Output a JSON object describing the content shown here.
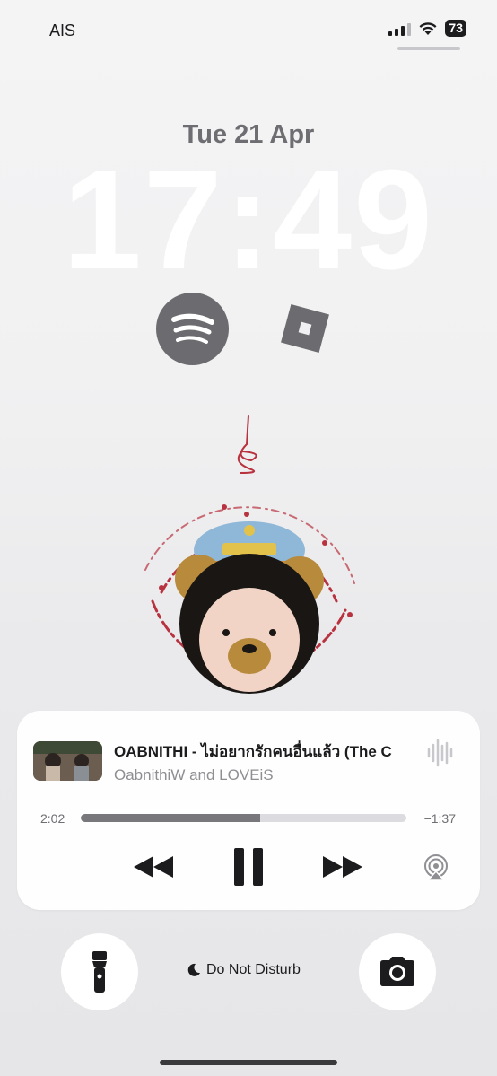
{
  "status_bar": {
    "carrier": "AIS",
    "battery": "73"
  },
  "lock_screen": {
    "date": "Tue 21 Apr",
    "time": "17:49",
    "widgets": [
      "spotify-icon",
      "roblox-icon"
    ]
  },
  "now_playing": {
    "title": "OABNITHI - ไม่อยากรักคนอื่นแล้ว (The C",
    "artist": "OabnithiW and LOVEiS",
    "elapsed": "2:02",
    "remaining": "−1:37",
    "progress": 0.55,
    "controls": [
      "rewind-icon",
      "pause-icon",
      "fast-forward-icon",
      "airplay-icon"
    ]
  },
  "bottom": {
    "dnd_label": "Do Not Disturb",
    "left_button": "flashlight-icon",
    "right_button": "camera-icon"
  },
  "colors": {
    "accent_text": "#1c1c1e",
    "wallpaper_ink": "#b8323f",
    "progress_fill": "#77777c"
  }
}
